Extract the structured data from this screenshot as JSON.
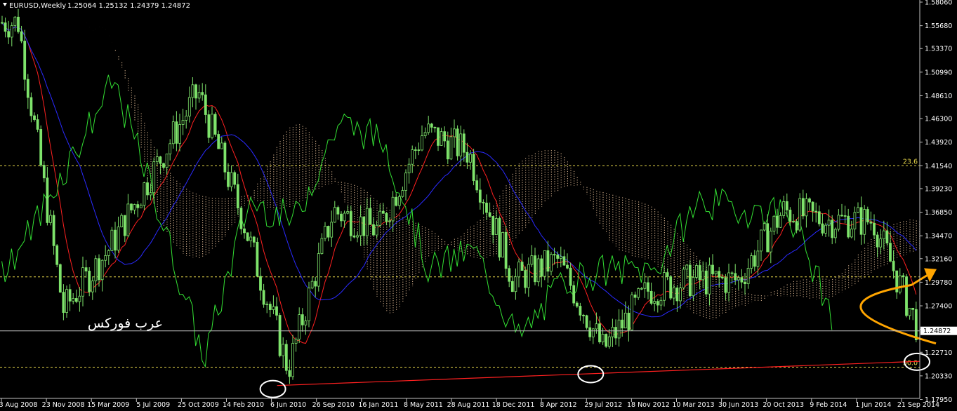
{
  "header": {
    "symbol": "EURUSD,Weekly",
    "ohlc": "1.25064 1.25132 1.24379 1.24872"
  },
  "watermark": "عرب فوركس",
  "colors": {
    "background": "#000000",
    "candle": "#7ee36b",
    "chikou": "#33e033",
    "tenkan": "#ff2020",
    "kijun": "#2a2aff",
    "kumo": "#f0c8a0",
    "level": "#e8d84a",
    "trend": "#ff2020",
    "arrow": "#ffa500",
    "circle": "#ffffff",
    "price_line": "#c0c0c0"
  },
  "chart_data": {
    "type": "candlestick",
    "y_range": [
      1.1848,
      1.5806
    ],
    "y_ticks": [
      "1.58060",
      "1.55680",
      "1.53370",
      "1.50990",
      "1.48610",
      "1.46300",
      "1.43920",
      "1.41540",
      "1.39230",
      "1.36850",
      "1.34470",
      "1.32160",
      "1.29780",
      "1.27400",
      "1.25020",
      "1.22710",
      "1.20330",
      "1.17950"
    ],
    "x_ticks": [
      "3 Aug 2008",
      "23 Nov 2008",
      "15 Mar 2009",
      "5 Jul 2009",
      "25 Oct 2009",
      "14 Feb 2010",
      "6 Jun 2010",
      "26 Sep 2010",
      "16 Jan 2011",
      "8 May 2011",
      "28 Aug 2011",
      "18 Dec 2011",
      "8 Apr 2012",
      "29 Jul 2012",
      "18 Nov 2012",
      "10 Mar 2013",
      "30 Jun 2013",
      "20 Oct 2013",
      "9 Feb 2014",
      "1 Jun 2014",
      "21 Sep 2014"
    ],
    "current_price": "1.24872",
    "fib_levels": [
      {
        "label": "23.6",
        "price": 1.4154
      },
      {
        "label": "",
        "price": 1.3032
      },
      {
        "label": "50.0",
        "price": 1.2121
      }
    ],
    "trendline": {
      "from": [
        "6 Jun 2010",
        1.1935
      ],
      "to": [
        "21 Sep 2014",
        1.218
      ]
    },
    "circled_lows": [
      [
        "6 Jun 2010",
        1.19
      ],
      [
        "29 Jul 2012",
        1.205
      ],
      [
        "21 Sep 2014",
        1.2175
      ]
    ],
    "close_path": [
      [
        "3 Aug 2008",
        1.56
      ],
      [
        "23 Nov 2008",
        1.27
      ],
      [
        "15 Mar 2009",
        1.33
      ],
      [
        "5 Jul 2009",
        1.41
      ],
      [
        "25 Oct 2009",
        1.49
      ],
      [
        "14 Feb 2010",
        1.36
      ],
      [
        "6 Jun 2010",
        1.21
      ],
      [
        "26 Sep 2010",
        1.37
      ],
      [
        "16 Jan 2011",
        1.35
      ],
      [
        "8 May 2011",
        1.45
      ],
      [
        "28 Aug 2011",
        1.43
      ],
      [
        "18 Dec 2011",
        1.3
      ],
      [
        "8 Apr 2012",
        1.32
      ],
      [
        "29 Jul 2012",
        1.23
      ],
      [
        "18 Nov 2012",
        1.29
      ],
      [
        "10 Mar 2013",
        1.3
      ],
      [
        "30 Jun 2013",
        1.3
      ],
      [
        "20 Oct 2013",
        1.37
      ],
      [
        "9 Feb 2014",
        1.36
      ],
      [
        "1 Jun 2014",
        1.36
      ],
      [
        "21 Sep 2014",
        1.25
      ]
    ]
  }
}
